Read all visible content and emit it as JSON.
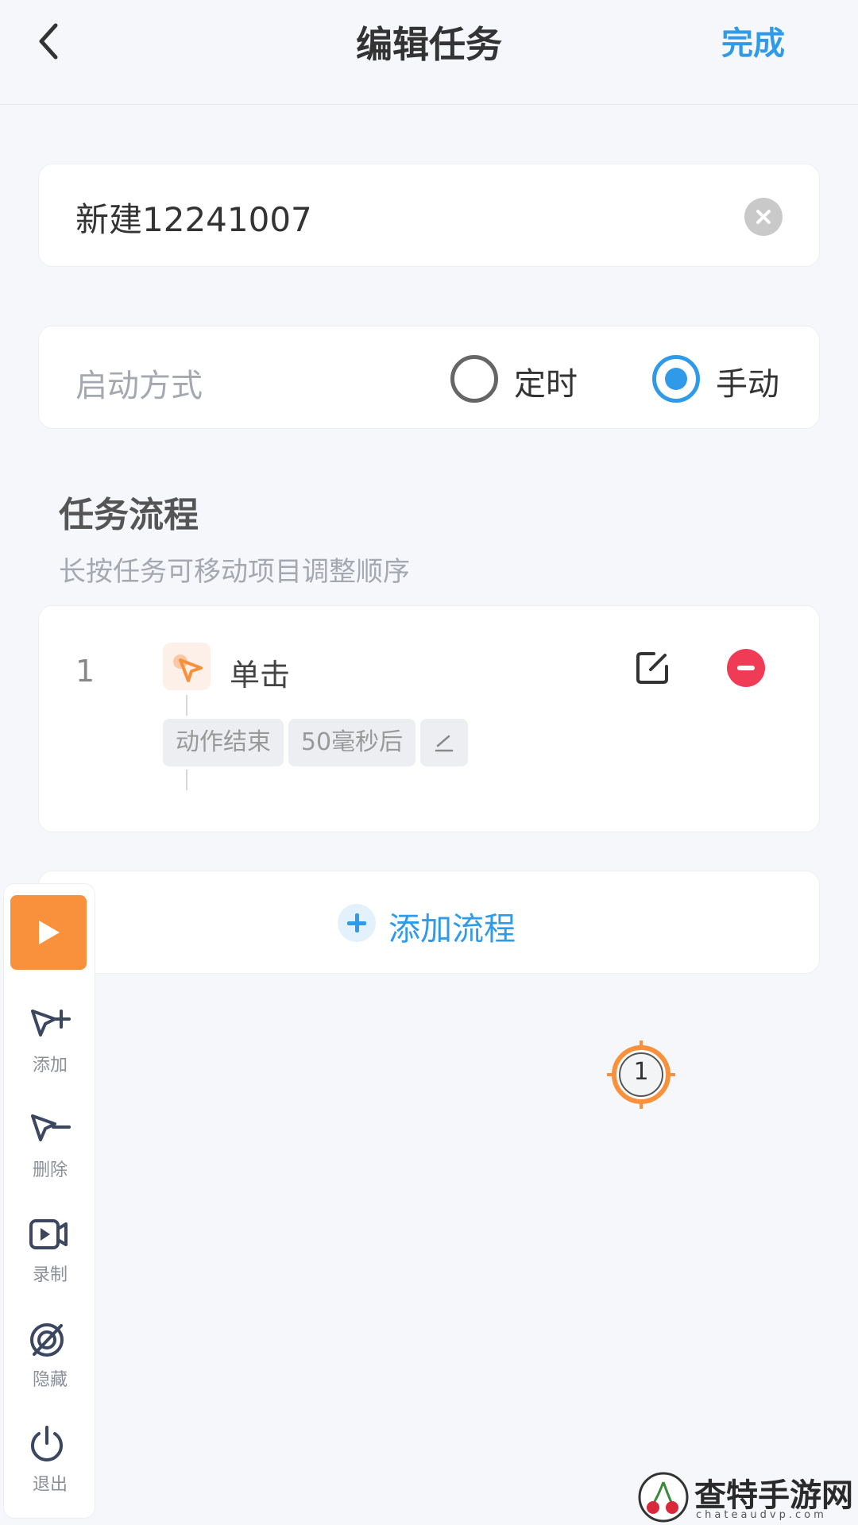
{
  "header": {
    "title": "编辑任务",
    "done_label": "完成"
  },
  "task_name": {
    "value": "新建12241007"
  },
  "start_mode": {
    "label": "启动方式",
    "options": [
      {
        "label": "定时",
        "selected": false
      },
      {
        "label": "手动",
        "selected": true
      }
    ]
  },
  "flow_section": {
    "title": "任务流程",
    "hint": "长按任务可移动项目调整顺序"
  },
  "steps": [
    {
      "index": "1",
      "action": "单击",
      "tags": [
        "动作结束",
        "50毫秒后"
      ]
    }
  ],
  "add_flow": {
    "label": "添加流程"
  },
  "toolbar": {
    "items": [
      {
        "label": "添加",
        "icon": "cursor-plus-icon"
      },
      {
        "label": "删除",
        "icon": "cursor-minus-icon"
      },
      {
        "label": "录制",
        "icon": "record-video-icon"
      },
      {
        "label": "隐藏",
        "icon": "eye-off-icon"
      },
      {
        "label": "退出",
        "icon": "power-icon"
      }
    ]
  },
  "click_marker": {
    "number": "1"
  },
  "watermark": {
    "text": "查特手游网",
    "sub": "chateaudvp.com"
  },
  "colors": {
    "accent": "#2f9be8",
    "danger": "#f03b57",
    "play": "#f9913c",
    "background": "#f6f7fb"
  }
}
